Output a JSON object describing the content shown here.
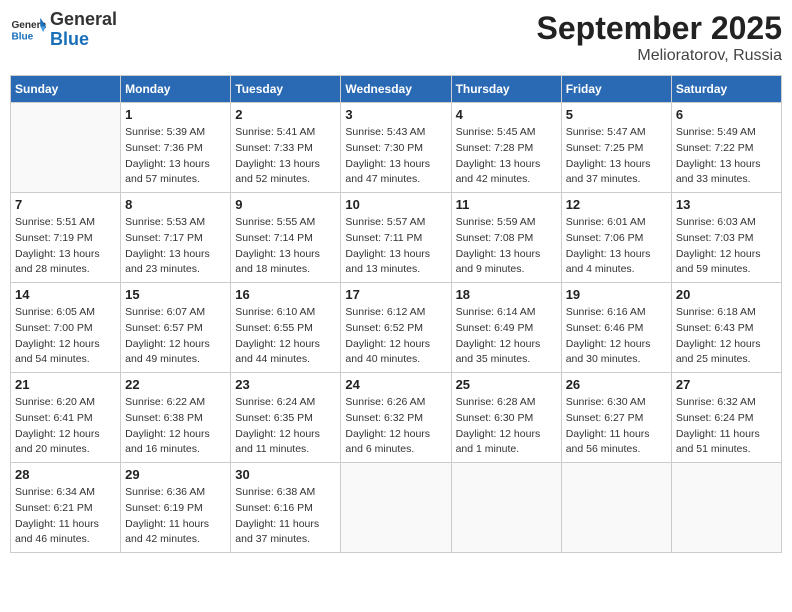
{
  "header": {
    "logo_text_general": "General",
    "logo_text_blue": "Blue",
    "month": "September 2025",
    "location": "Melioratorov, Russia"
  },
  "weekdays": [
    "Sunday",
    "Monday",
    "Tuesday",
    "Wednesday",
    "Thursday",
    "Friday",
    "Saturday"
  ],
  "weeks": [
    [
      {
        "day": "",
        "info": ""
      },
      {
        "day": "1",
        "info": "Sunrise: 5:39 AM\nSunset: 7:36 PM\nDaylight: 13 hours\nand 57 minutes."
      },
      {
        "day": "2",
        "info": "Sunrise: 5:41 AM\nSunset: 7:33 PM\nDaylight: 13 hours\nand 52 minutes."
      },
      {
        "day": "3",
        "info": "Sunrise: 5:43 AM\nSunset: 7:30 PM\nDaylight: 13 hours\nand 47 minutes."
      },
      {
        "day": "4",
        "info": "Sunrise: 5:45 AM\nSunset: 7:28 PM\nDaylight: 13 hours\nand 42 minutes."
      },
      {
        "day": "5",
        "info": "Sunrise: 5:47 AM\nSunset: 7:25 PM\nDaylight: 13 hours\nand 37 minutes."
      },
      {
        "day": "6",
        "info": "Sunrise: 5:49 AM\nSunset: 7:22 PM\nDaylight: 13 hours\nand 33 minutes."
      }
    ],
    [
      {
        "day": "7",
        "info": "Sunrise: 5:51 AM\nSunset: 7:19 PM\nDaylight: 13 hours\nand 28 minutes."
      },
      {
        "day": "8",
        "info": "Sunrise: 5:53 AM\nSunset: 7:17 PM\nDaylight: 13 hours\nand 23 minutes."
      },
      {
        "day": "9",
        "info": "Sunrise: 5:55 AM\nSunset: 7:14 PM\nDaylight: 13 hours\nand 18 minutes."
      },
      {
        "day": "10",
        "info": "Sunrise: 5:57 AM\nSunset: 7:11 PM\nDaylight: 13 hours\nand 13 minutes."
      },
      {
        "day": "11",
        "info": "Sunrise: 5:59 AM\nSunset: 7:08 PM\nDaylight: 13 hours\nand 9 minutes."
      },
      {
        "day": "12",
        "info": "Sunrise: 6:01 AM\nSunset: 7:06 PM\nDaylight: 13 hours\nand 4 minutes."
      },
      {
        "day": "13",
        "info": "Sunrise: 6:03 AM\nSunset: 7:03 PM\nDaylight: 12 hours\nand 59 minutes."
      }
    ],
    [
      {
        "day": "14",
        "info": "Sunrise: 6:05 AM\nSunset: 7:00 PM\nDaylight: 12 hours\nand 54 minutes."
      },
      {
        "day": "15",
        "info": "Sunrise: 6:07 AM\nSunset: 6:57 PM\nDaylight: 12 hours\nand 49 minutes."
      },
      {
        "day": "16",
        "info": "Sunrise: 6:10 AM\nSunset: 6:55 PM\nDaylight: 12 hours\nand 44 minutes."
      },
      {
        "day": "17",
        "info": "Sunrise: 6:12 AM\nSunset: 6:52 PM\nDaylight: 12 hours\nand 40 minutes."
      },
      {
        "day": "18",
        "info": "Sunrise: 6:14 AM\nSunset: 6:49 PM\nDaylight: 12 hours\nand 35 minutes."
      },
      {
        "day": "19",
        "info": "Sunrise: 6:16 AM\nSunset: 6:46 PM\nDaylight: 12 hours\nand 30 minutes."
      },
      {
        "day": "20",
        "info": "Sunrise: 6:18 AM\nSunset: 6:43 PM\nDaylight: 12 hours\nand 25 minutes."
      }
    ],
    [
      {
        "day": "21",
        "info": "Sunrise: 6:20 AM\nSunset: 6:41 PM\nDaylight: 12 hours\nand 20 minutes."
      },
      {
        "day": "22",
        "info": "Sunrise: 6:22 AM\nSunset: 6:38 PM\nDaylight: 12 hours\nand 16 minutes."
      },
      {
        "day": "23",
        "info": "Sunrise: 6:24 AM\nSunset: 6:35 PM\nDaylight: 12 hours\nand 11 minutes."
      },
      {
        "day": "24",
        "info": "Sunrise: 6:26 AM\nSunset: 6:32 PM\nDaylight: 12 hours\nand 6 minutes."
      },
      {
        "day": "25",
        "info": "Sunrise: 6:28 AM\nSunset: 6:30 PM\nDaylight: 12 hours\nand 1 minute."
      },
      {
        "day": "26",
        "info": "Sunrise: 6:30 AM\nSunset: 6:27 PM\nDaylight: 11 hours\nand 56 minutes."
      },
      {
        "day": "27",
        "info": "Sunrise: 6:32 AM\nSunset: 6:24 PM\nDaylight: 11 hours\nand 51 minutes."
      }
    ],
    [
      {
        "day": "28",
        "info": "Sunrise: 6:34 AM\nSunset: 6:21 PM\nDaylight: 11 hours\nand 46 minutes."
      },
      {
        "day": "29",
        "info": "Sunrise: 6:36 AM\nSunset: 6:19 PM\nDaylight: 11 hours\nand 42 minutes."
      },
      {
        "day": "30",
        "info": "Sunrise: 6:38 AM\nSunset: 6:16 PM\nDaylight: 11 hours\nand 37 minutes."
      },
      {
        "day": "",
        "info": ""
      },
      {
        "day": "",
        "info": ""
      },
      {
        "day": "",
        "info": ""
      },
      {
        "day": "",
        "info": ""
      }
    ]
  ]
}
